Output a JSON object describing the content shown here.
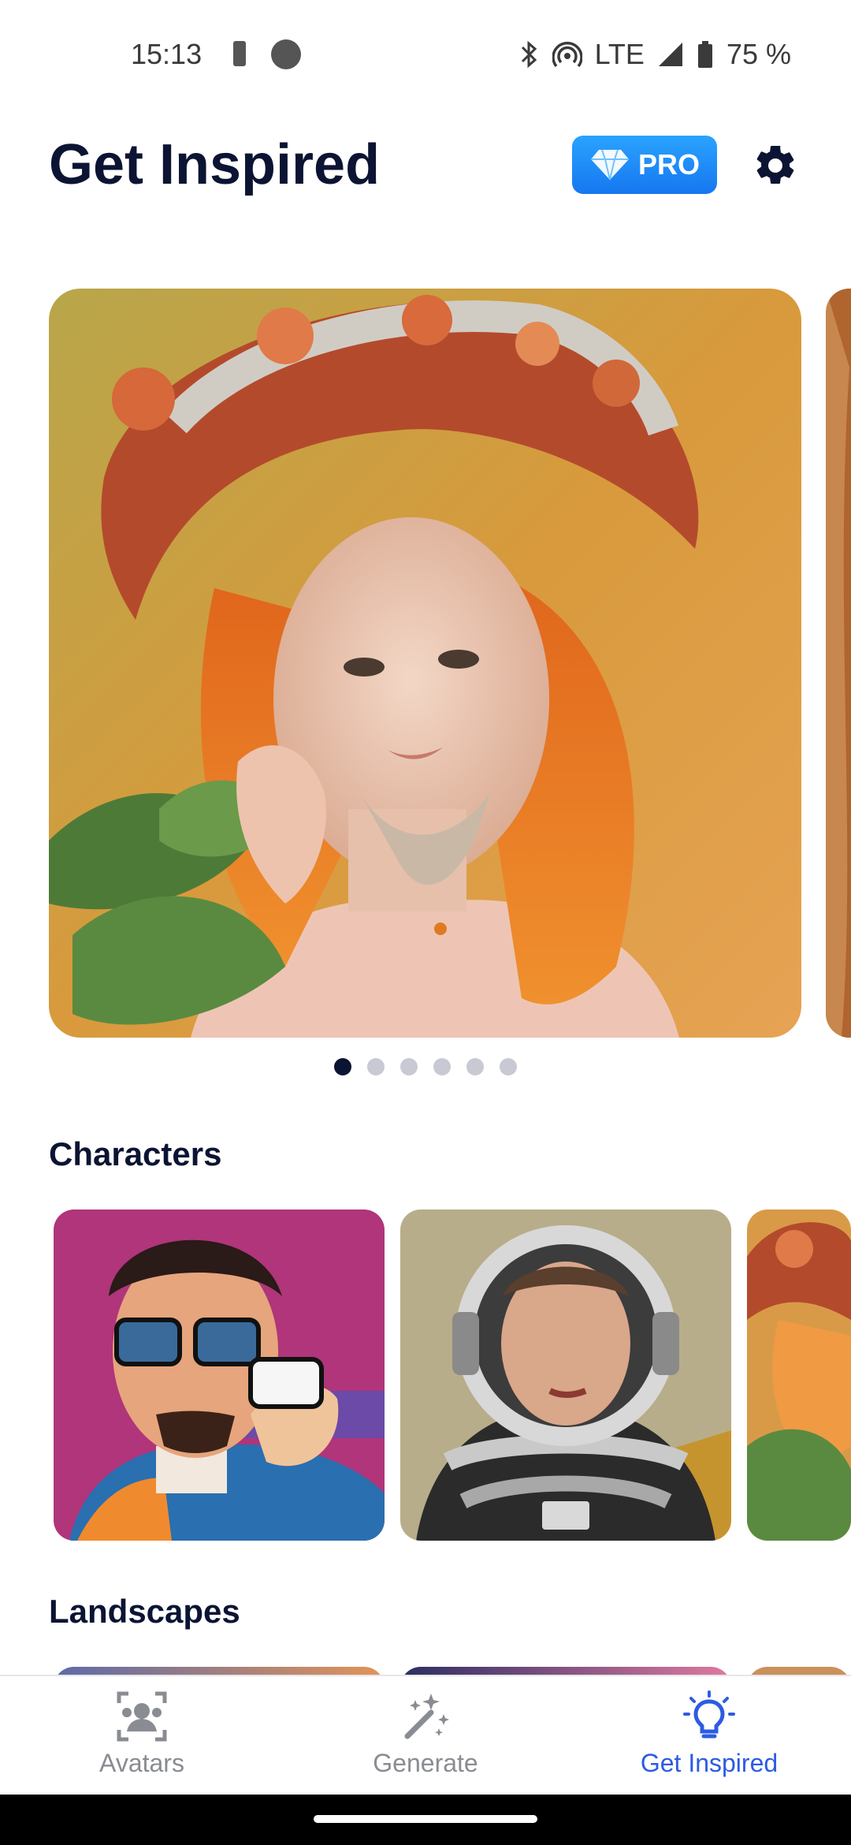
{
  "status": {
    "time": "15:13",
    "network": "LTE",
    "battery": "75 %"
  },
  "header": {
    "title": "Get Inspired",
    "pro_label": "PRO"
  },
  "carousel": {
    "pages": 6,
    "active_index": 0
  },
  "sections": {
    "characters": "Characters",
    "landscapes": "Landscapes"
  },
  "nav": {
    "items": [
      {
        "label": "Avatars",
        "icon": "avatars-icon",
        "active": false
      },
      {
        "label": "Generate",
        "icon": "magic-wand-icon",
        "active": false
      },
      {
        "label": "Get Inspired",
        "icon": "lightbulb-icon",
        "active": true
      }
    ]
  },
  "colors": {
    "accent": "#2d5be3",
    "title": "#0c1433",
    "pro_gradient_top": "#2aa3ff",
    "pro_gradient_bottom": "#1677f0"
  }
}
